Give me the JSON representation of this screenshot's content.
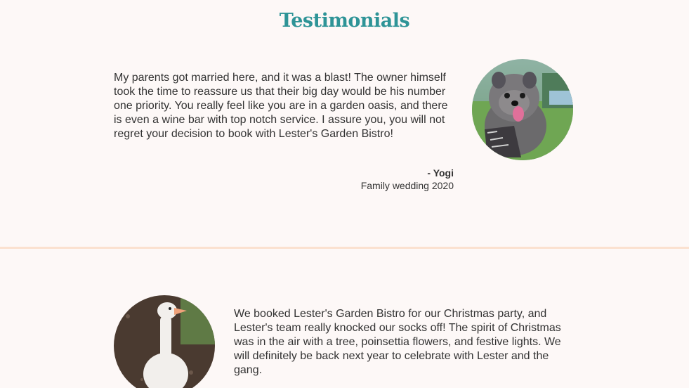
{
  "colors": {
    "heading": "#2e9497",
    "divider": "#fbe1d0",
    "background": "#fdf8f7",
    "text": "#333333"
  },
  "section": {
    "title": "Testimonials"
  },
  "testimonials": [
    {
      "quote": "My parents got married here, and it was a blast! The owner himself took the time to reassure us that their big day would be his number one priority. You really feel like you are in a garden oasis, and there is even a wine bar with top notch service. I assure you, you will not regret your decision to book with Lester's Garden Bistro!",
      "author": "- Yogi",
      "event": "Family wedding 2020",
      "photo": "dog-photo"
    },
    {
      "quote": "We booked Lester's Garden Bistro for our Christmas party, and Lester's team really knocked our socks off! The spirit of Christmas was in the air with a tree, poinsettia flowers, and festive lights. We will definitely be back next year to celebrate with Lester and the gang.",
      "photo": "goose-photo"
    }
  ]
}
